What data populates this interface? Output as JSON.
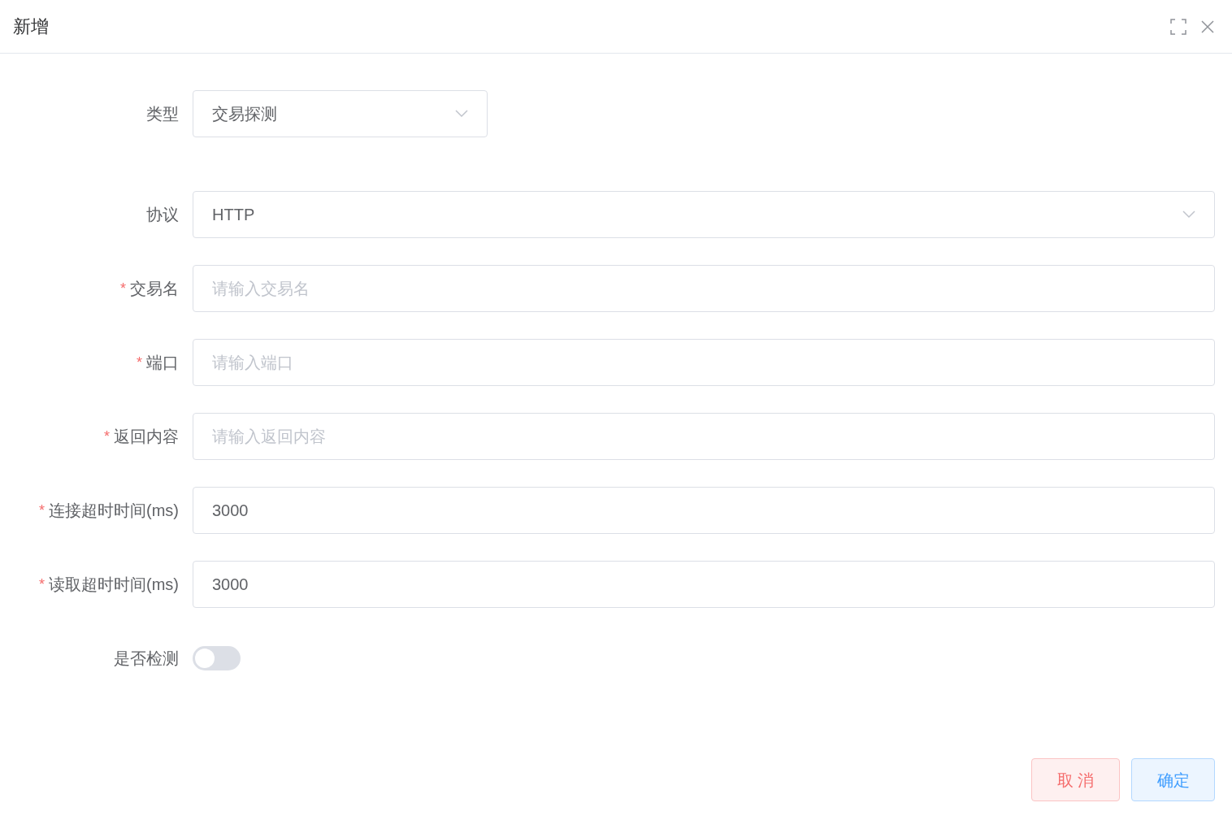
{
  "dialog": {
    "title": "新增"
  },
  "fields": [
    {
      "kind": "select",
      "label": "类型",
      "value": "交易探测"
    },
    {
      "kind": "select",
      "label": "协议",
      "value": "HTTP"
    },
    {
      "kind": "input",
      "required_mark": "*",
      "label": "交易名",
      "placeholder": "请输入交易名"
    },
    {
      "kind": "input",
      "required_mark": "*",
      "label": "端口",
      "placeholder": "请输入端口"
    },
    {
      "kind": "input",
      "required_mark": "*",
      "label": "返回内容",
      "placeholder": "请输入返回内容"
    },
    {
      "kind": "input",
      "required_mark": "*",
      "label": "连接超时时间(ms)",
      "value": "3000"
    },
    {
      "kind": "input",
      "required_mark": "*",
      "label": "读取超时时间(ms)",
      "value": "3000"
    },
    {
      "kind": "switch",
      "label": "是否检测",
      "on": false
    }
  ],
  "buttons": [
    {
      "kind": "cancel",
      "label": "取 消"
    },
    {
      "kind": "confirm",
      "label": "确定"
    }
  ]
}
